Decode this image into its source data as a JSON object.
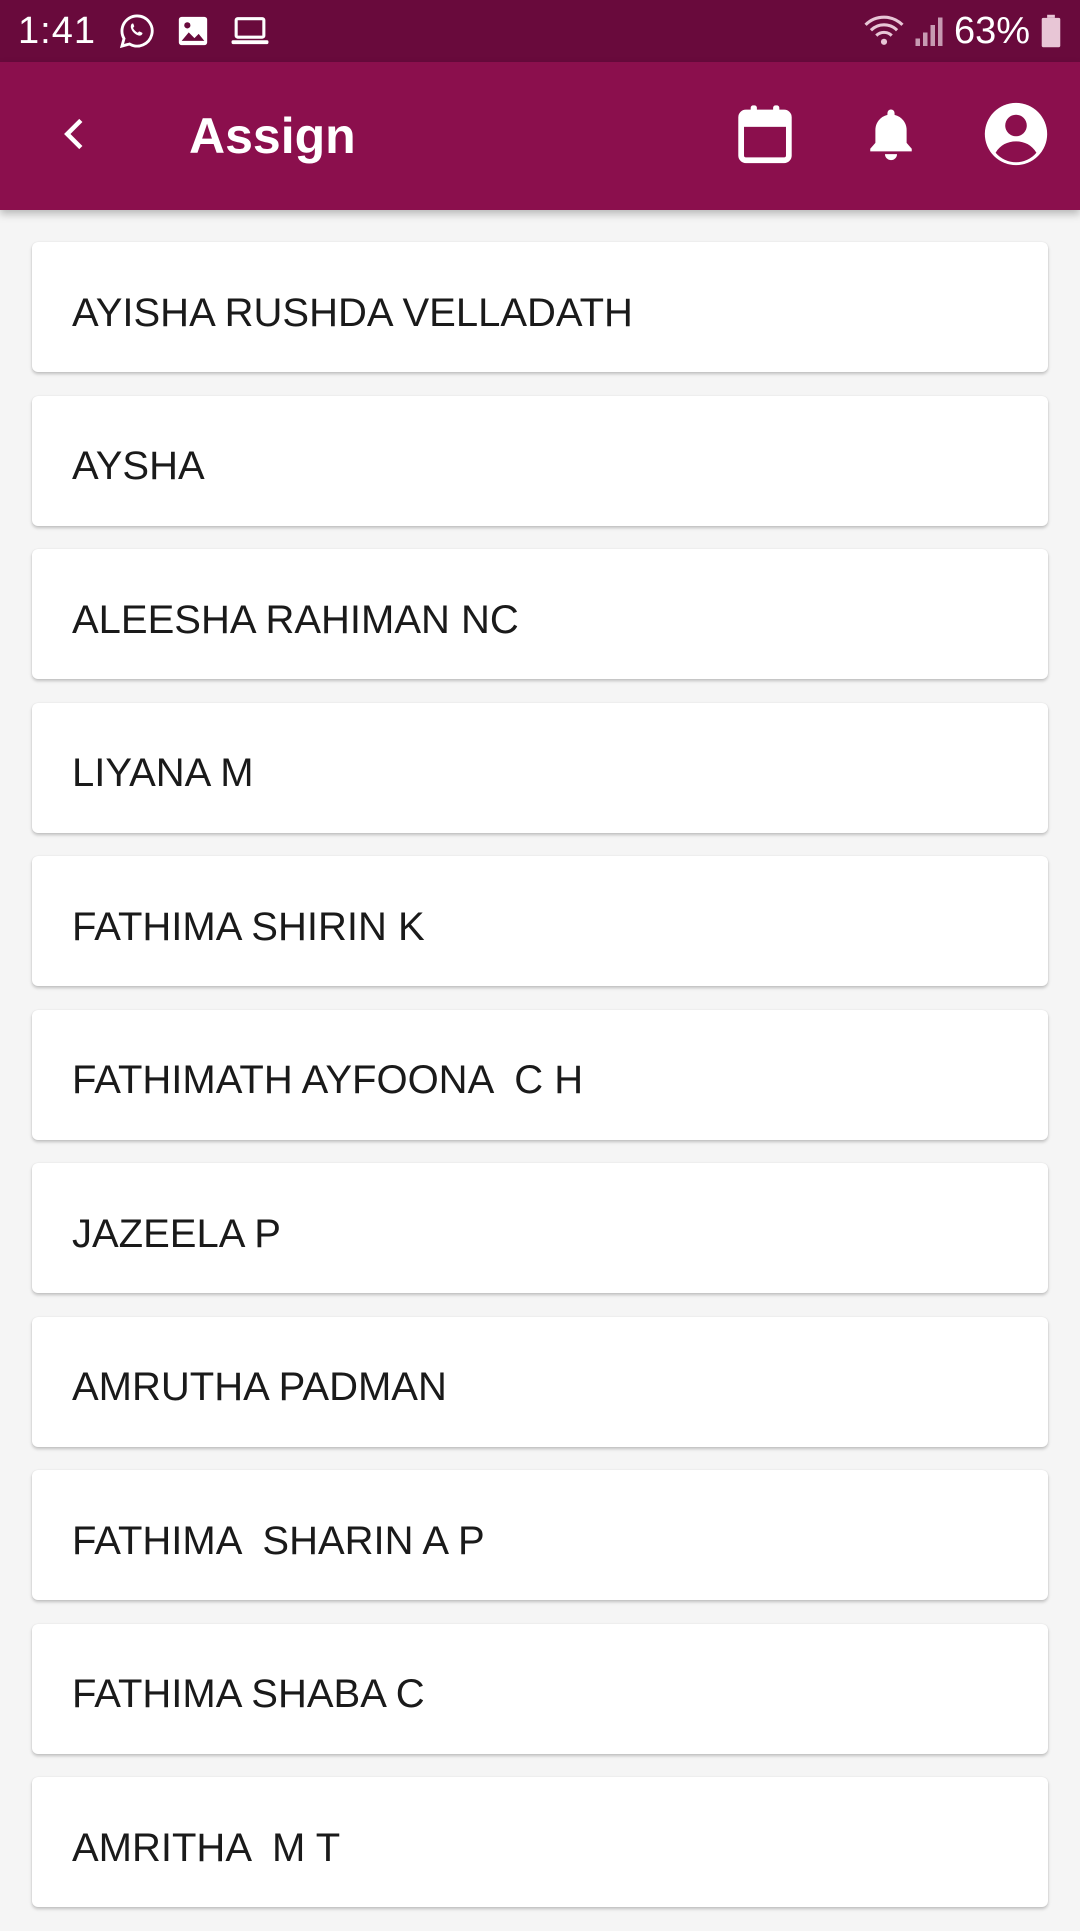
{
  "status_bar": {
    "time": "1:41",
    "battery": "63%",
    "icons": [
      "whatsapp-icon",
      "gallery-icon",
      "laptop-icon",
      "wifi-icon",
      "signal-icon",
      "battery-icon"
    ]
  },
  "app_bar": {
    "title": "Assign",
    "background_color": "#8b0f4d",
    "status_color": "#690a3c",
    "actions": [
      "back-icon",
      "calendar-icon",
      "bell-icon",
      "account-icon"
    ]
  },
  "students": [
    "AYISHA RUSHDA VELLADATH",
    "AYSHA",
    "ALEESHA RAHIMAN NC",
    "LIYANA M",
    "FATHIMA SHIRIN K",
    "FATHIMATH AYFOONA  C H",
    "JAZEELA P",
    "AMRUTHA PADMAN",
    "FATHIMA  SHARIN A P",
    "FATHIMA SHABA C",
    "AMRITHA  M T"
  ]
}
